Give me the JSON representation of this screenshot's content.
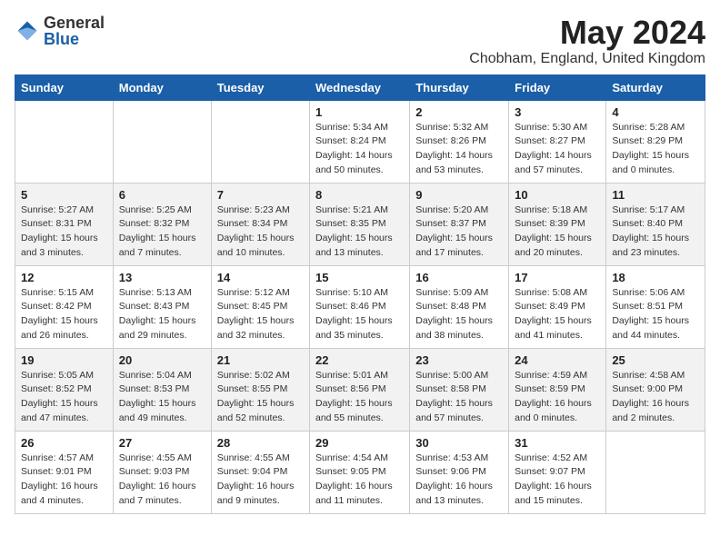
{
  "logo": {
    "general": "General",
    "blue": "Blue"
  },
  "title": "May 2024",
  "location": "Chobham, England, United Kingdom",
  "headers": [
    "Sunday",
    "Monday",
    "Tuesday",
    "Wednesday",
    "Thursday",
    "Friday",
    "Saturday"
  ],
  "weeks": [
    [
      {
        "day": "",
        "sunrise": "",
        "sunset": "",
        "daylight": ""
      },
      {
        "day": "",
        "sunrise": "",
        "sunset": "",
        "daylight": ""
      },
      {
        "day": "",
        "sunrise": "",
        "sunset": "",
        "daylight": ""
      },
      {
        "day": "1",
        "sunrise": "Sunrise: 5:34 AM",
        "sunset": "Sunset: 8:24 PM",
        "daylight": "Daylight: 14 hours and 50 minutes."
      },
      {
        "day": "2",
        "sunrise": "Sunrise: 5:32 AM",
        "sunset": "Sunset: 8:26 PM",
        "daylight": "Daylight: 14 hours and 53 minutes."
      },
      {
        "day": "3",
        "sunrise": "Sunrise: 5:30 AM",
        "sunset": "Sunset: 8:27 PM",
        "daylight": "Daylight: 14 hours and 57 minutes."
      },
      {
        "day": "4",
        "sunrise": "Sunrise: 5:28 AM",
        "sunset": "Sunset: 8:29 PM",
        "daylight": "Daylight: 15 hours and 0 minutes."
      }
    ],
    [
      {
        "day": "5",
        "sunrise": "Sunrise: 5:27 AM",
        "sunset": "Sunset: 8:31 PM",
        "daylight": "Daylight: 15 hours and 3 minutes."
      },
      {
        "day": "6",
        "sunrise": "Sunrise: 5:25 AM",
        "sunset": "Sunset: 8:32 PM",
        "daylight": "Daylight: 15 hours and 7 minutes."
      },
      {
        "day": "7",
        "sunrise": "Sunrise: 5:23 AM",
        "sunset": "Sunset: 8:34 PM",
        "daylight": "Daylight: 15 hours and 10 minutes."
      },
      {
        "day": "8",
        "sunrise": "Sunrise: 5:21 AM",
        "sunset": "Sunset: 8:35 PM",
        "daylight": "Daylight: 15 hours and 13 minutes."
      },
      {
        "day": "9",
        "sunrise": "Sunrise: 5:20 AM",
        "sunset": "Sunset: 8:37 PM",
        "daylight": "Daylight: 15 hours and 17 minutes."
      },
      {
        "day": "10",
        "sunrise": "Sunrise: 5:18 AM",
        "sunset": "Sunset: 8:39 PM",
        "daylight": "Daylight: 15 hours and 20 minutes."
      },
      {
        "day": "11",
        "sunrise": "Sunrise: 5:17 AM",
        "sunset": "Sunset: 8:40 PM",
        "daylight": "Daylight: 15 hours and 23 minutes."
      }
    ],
    [
      {
        "day": "12",
        "sunrise": "Sunrise: 5:15 AM",
        "sunset": "Sunset: 8:42 PM",
        "daylight": "Daylight: 15 hours and 26 minutes."
      },
      {
        "day": "13",
        "sunrise": "Sunrise: 5:13 AM",
        "sunset": "Sunset: 8:43 PM",
        "daylight": "Daylight: 15 hours and 29 minutes."
      },
      {
        "day": "14",
        "sunrise": "Sunrise: 5:12 AM",
        "sunset": "Sunset: 8:45 PM",
        "daylight": "Daylight: 15 hours and 32 minutes."
      },
      {
        "day": "15",
        "sunrise": "Sunrise: 5:10 AM",
        "sunset": "Sunset: 8:46 PM",
        "daylight": "Daylight: 15 hours and 35 minutes."
      },
      {
        "day": "16",
        "sunrise": "Sunrise: 5:09 AM",
        "sunset": "Sunset: 8:48 PM",
        "daylight": "Daylight: 15 hours and 38 minutes."
      },
      {
        "day": "17",
        "sunrise": "Sunrise: 5:08 AM",
        "sunset": "Sunset: 8:49 PM",
        "daylight": "Daylight: 15 hours and 41 minutes."
      },
      {
        "day": "18",
        "sunrise": "Sunrise: 5:06 AM",
        "sunset": "Sunset: 8:51 PM",
        "daylight": "Daylight: 15 hours and 44 minutes."
      }
    ],
    [
      {
        "day": "19",
        "sunrise": "Sunrise: 5:05 AM",
        "sunset": "Sunset: 8:52 PM",
        "daylight": "Daylight: 15 hours and 47 minutes."
      },
      {
        "day": "20",
        "sunrise": "Sunrise: 5:04 AM",
        "sunset": "Sunset: 8:53 PM",
        "daylight": "Daylight: 15 hours and 49 minutes."
      },
      {
        "day": "21",
        "sunrise": "Sunrise: 5:02 AM",
        "sunset": "Sunset: 8:55 PM",
        "daylight": "Daylight: 15 hours and 52 minutes."
      },
      {
        "day": "22",
        "sunrise": "Sunrise: 5:01 AM",
        "sunset": "Sunset: 8:56 PM",
        "daylight": "Daylight: 15 hours and 55 minutes."
      },
      {
        "day": "23",
        "sunrise": "Sunrise: 5:00 AM",
        "sunset": "Sunset: 8:58 PM",
        "daylight": "Daylight: 15 hours and 57 minutes."
      },
      {
        "day": "24",
        "sunrise": "Sunrise: 4:59 AM",
        "sunset": "Sunset: 8:59 PM",
        "daylight": "Daylight: 16 hours and 0 minutes."
      },
      {
        "day": "25",
        "sunrise": "Sunrise: 4:58 AM",
        "sunset": "Sunset: 9:00 PM",
        "daylight": "Daylight: 16 hours and 2 minutes."
      }
    ],
    [
      {
        "day": "26",
        "sunrise": "Sunrise: 4:57 AM",
        "sunset": "Sunset: 9:01 PM",
        "daylight": "Daylight: 16 hours and 4 minutes."
      },
      {
        "day": "27",
        "sunrise": "Sunrise: 4:55 AM",
        "sunset": "Sunset: 9:03 PM",
        "daylight": "Daylight: 16 hours and 7 minutes."
      },
      {
        "day": "28",
        "sunrise": "Sunrise: 4:55 AM",
        "sunset": "Sunset: 9:04 PM",
        "daylight": "Daylight: 16 hours and 9 minutes."
      },
      {
        "day": "29",
        "sunrise": "Sunrise: 4:54 AM",
        "sunset": "Sunset: 9:05 PM",
        "daylight": "Daylight: 16 hours and 11 minutes."
      },
      {
        "day": "30",
        "sunrise": "Sunrise: 4:53 AM",
        "sunset": "Sunset: 9:06 PM",
        "daylight": "Daylight: 16 hours and 13 minutes."
      },
      {
        "day": "31",
        "sunrise": "Sunrise: 4:52 AM",
        "sunset": "Sunset: 9:07 PM",
        "daylight": "Daylight: 16 hours and 15 minutes."
      },
      {
        "day": "",
        "sunrise": "",
        "sunset": "",
        "daylight": ""
      }
    ]
  ]
}
